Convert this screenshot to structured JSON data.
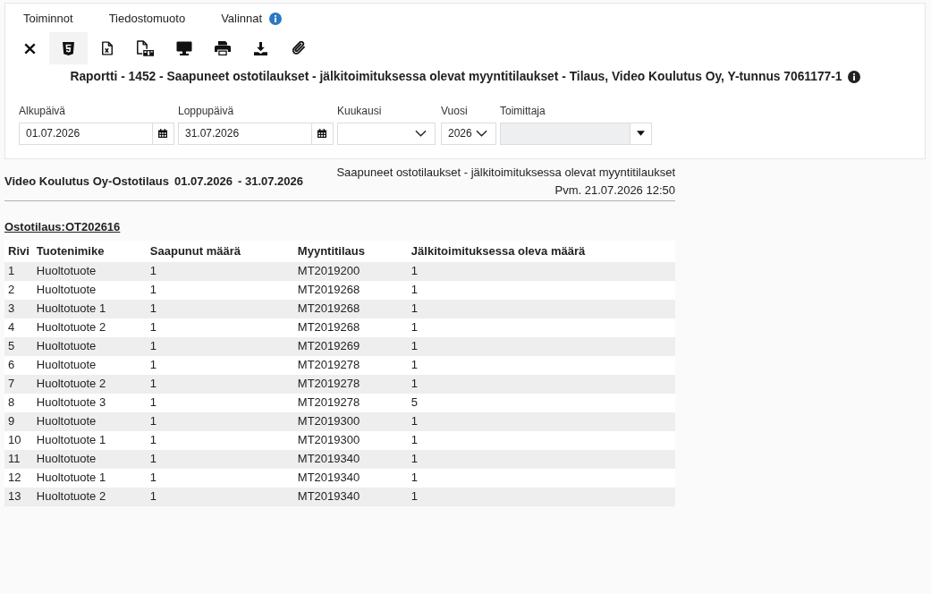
{
  "menu": [
    {
      "label": "Toiminnot",
      "info_icon": false
    },
    {
      "label": "Tiedostomuoto",
      "info_icon": false
    },
    {
      "label": "Valinnat",
      "info_icon": true
    }
  ],
  "toolbar": [
    {
      "kind": "close",
      "selected": false
    },
    {
      "kind": "html",
      "selected": true
    },
    {
      "kind": "excel",
      "selected": false
    },
    {
      "kind": "pdf",
      "selected": false
    },
    {
      "kind": "screen",
      "selected": false
    },
    {
      "kind": "print",
      "selected": false
    },
    {
      "kind": "download",
      "selected": false
    },
    {
      "kind": "attachment",
      "selected": false
    }
  ],
  "title": {
    "text": "Raportti - 1452 - Saapuneet ostotilaukset - jälkitoimituksessa olevat myyntitilaukset - Tilaus, Video Koulutus Oy, Y-tunnus 7061177-1",
    "info_icon": true
  },
  "filters": [
    {
      "kind": "date",
      "label": "Alkupäivä",
      "value": "01.07.2026",
      "disabled": false
    },
    {
      "kind": "date",
      "label": "Loppupäivä",
      "value": "31.07.2026",
      "disabled": false
    },
    {
      "kind": "select",
      "label": "Kuukausi",
      "disabled": false
    },
    {
      "kind": "select",
      "label": "Vuosi",
      "value": "2026",
      "disabled": false
    },
    {
      "kind": "combo",
      "label": "Toimittaja",
      "disabled": true
    }
  ],
  "report": {
    "company": "Video Koulutus Oy-Ostotilaus",
    "period_start": "01.07.2026",
    "period_end": "- 31.07.2026",
    "subtitle": "Saapuneet ostotilaukset - jälkitoimituksessa olevat myyntitilaukset",
    "printed": "Pvm. 21.07.2026 12:50",
    "order": "Ostotilaus:OT202616",
    "table": {
      "columns": [
        "Rivi",
        "Tuotenimike",
        "Saapunut määrä",
        "Myyntitilaus",
        "Jälkitoimituksessa oleva määrä"
      ],
      "rows": [
        [
          "1",
          "Huoltotuote",
          "1",
          "MT2019200",
          "1"
        ],
        [
          "2",
          "Huoltotuote",
          "1",
          "MT2019268",
          "1"
        ],
        [
          "3",
          "Huoltotuote 1",
          "1",
          "MT2019268",
          "1"
        ],
        [
          "4",
          "Huoltotuote 2",
          "1",
          "MT2019268",
          "1"
        ],
        [
          "5",
          "Huoltotuote",
          "1",
          "MT2019269",
          "1"
        ],
        [
          "6",
          "Huoltotuote",
          "1",
          "MT2019278",
          "1"
        ],
        [
          "7",
          "Huoltotuote 2",
          "1",
          "MT2019278",
          "1"
        ],
        [
          "8",
          "Huoltotuote 3",
          "1",
          "MT2019278",
          "5"
        ],
        [
          "9",
          "Huoltotuote",
          "1",
          "MT2019300",
          "1"
        ],
        [
          "10",
          "Huoltotuote 1",
          "1",
          "MT2019300",
          "1"
        ],
        [
          "11",
          "Huoltotuote",
          "1",
          "MT2019340",
          "1"
        ],
        [
          "12",
          "Huoltotuote 1",
          "1",
          "MT2019340",
          "1"
        ],
        [
          "13",
          "Huoltotuote 2",
          "1",
          "MT2019340",
          "1"
        ]
      ]
    }
  }
}
